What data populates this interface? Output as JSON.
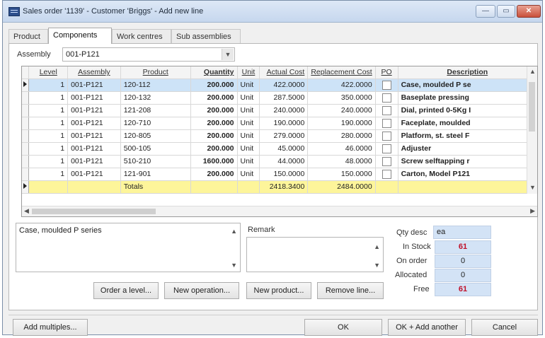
{
  "window": {
    "title": "Sales order '1139' - Customer 'Briggs' - Add new line",
    "minimize": "—",
    "maximize": "▭",
    "close": "✕"
  },
  "tabs": [
    "Product",
    "Components",
    "Work centres",
    "Sub assemblies"
  ],
  "assembly": {
    "label": "Assembly",
    "value": "001-P121"
  },
  "grid": {
    "columns": [
      "Level",
      "Assembly",
      "Product",
      "Quantity",
      "Unit",
      "Actual Cost",
      "Replacement Cost",
      "PO",
      "Description"
    ],
    "rows": [
      {
        "level": "1",
        "assembly": "001-P121",
        "product": "120-112",
        "quantity": "200.000",
        "unit": "Unit",
        "actual": "422.0000",
        "replacement": "422.0000",
        "desc": "Case, moulded P se"
      },
      {
        "level": "1",
        "assembly": "001-P121",
        "product": "120-132",
        "quantity": "200.000",
        "unit": "Unit",
        "actual": "287.5000",
        "replacement": "350.0000",
        "desc": "Baseplate pressing"
      },
      {
        "level": "1",
        "assembly": "001-P121",
        "product": "121-208",
        "quantity": "200.000",
        "unit": "Unit",
        "actual": "240.0000",
        "replacement": "240.0000",
        "desc": "Dial, printed 0-5Kg I"
      },
      {
        "level": "1",
        "assembly": "001-P121",
        "product": "120-710",
        "quantity": "200.000",
        "unit": "Unit",
        "actual": "190.0000",
        "replacement": "190.0000",
        "desc": "Faceplate, moulded"
      },
      {
        "level": "1",
        "assembly": "001-P121",
        "product": "120-805",
        "quantity": "200.000",
        "unit": "Unit",
        "actual": "279.0000",
        "replacement": "280.0000",
        "desc": "Platform, st. steel F"
      },
      {
        "level": "1",
        "assembly": "001-P121",
        "product": "500-105",
        "quantity": "200.000",
        "unit": "Unit",
        "actual": "45.0000",
        "replacement": "46.0000",
        "desc": "Adjuster"
      },
      {
        "level": "1",
        "assembly": "001-P121",
        "product": "510-210",
        "quantity": "1600.000",
        "unit": "Unit",
        "actual": "44.0000",
        "replacement": "48.0000",
        "desc": "Screw selftapping r"
      },
      {
        "level": "1",
        "assembly": "001-P121",
        "product": "121-901",
        "quantity": "200.000",
        "unit": "Unit",
        "actual": "150.0000",
        "replacement": "150.0000",
        "desc": "Carton, Model P121"
      }
    ],
    "totals": {
      "label": "Totals",
      "actual": "2418.3400",
      "replacement": "2484.0000"
    }
  },
  "description_text": "Case, moulded P series",
  "remark": {
    "label": "Remark",
    "value": ""
  },
  "stock": {
    "qty_desc_label": "Qty desc",
    "qty_desc": "ea",
    "in_stock_label": "In Stock",
    "in_stock": "61",
    "on_order_label": "On order",
    "on_order": "0",
    "allocated_label": "Allocated",
    "allocated": "0",
    "free_label": "Free",
    "free": "61"
  },
  "buttons": {
    "order_level": "Order a level...",
    "new_operation": "New operation...",
    "new_product": "New product...",
    "remove_line": "Remove line...",
    "add_multiples": "Add multiples...",
    "ok": "OK",
    "ok_add_another": "OK + Add another",
    "cancel": "Cancel"
  }
}
